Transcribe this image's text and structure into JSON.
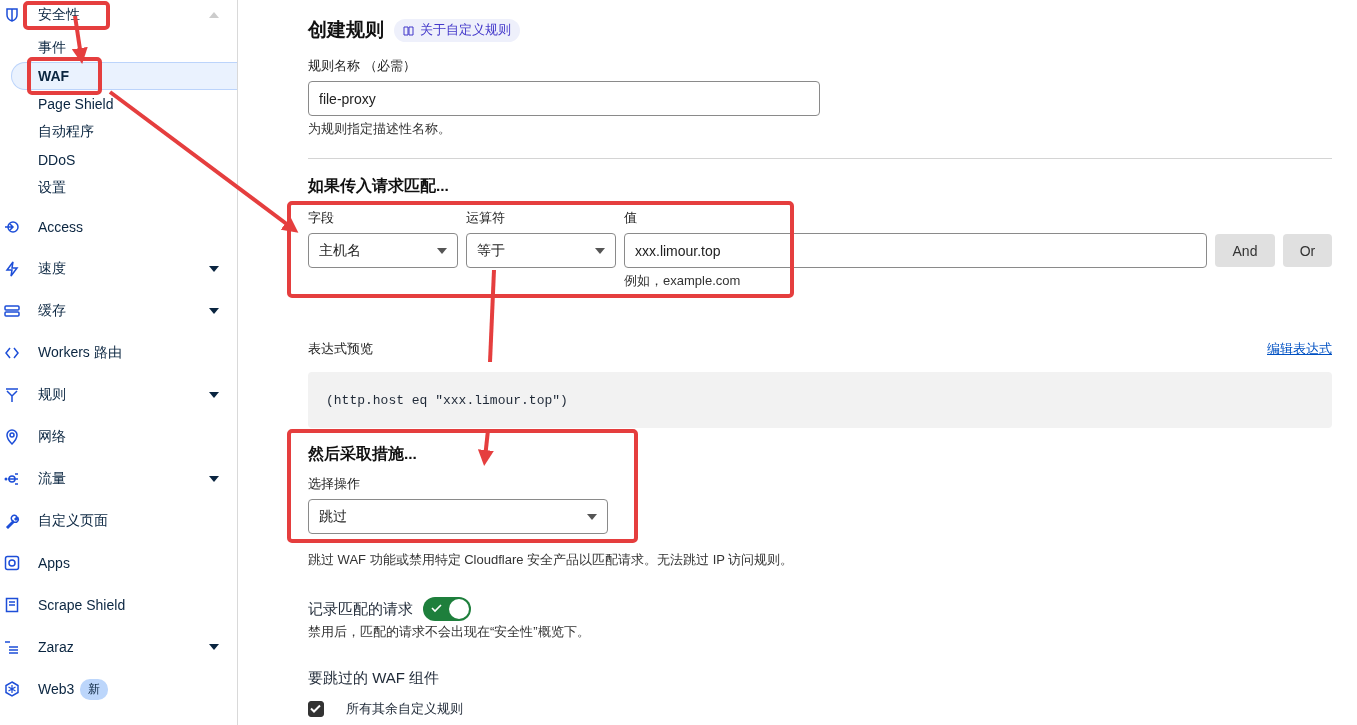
{
  "sidebar": {
    "items": [
      {
        "label": "安全性",
        "expanded": true,
        "children": [
          {
            "label": "事件",
            "selected": false
          },
          {
            "label": "WAF",
            "selected": true
          },
          {
            "label": "Page Shield",
            "selected": false
          },
          {
            "label": "自动程序",
            "selected": false
          },
          {
            "label": "DDoS",
            "selected": false
          },
          {
            "label": "设置",
            "selected": false
          }
        ]
      },
      {
        "label": "Access"
      },
      {
        "label": "速度",
        "expanded": false
      },
      {
        "label": "缓存",
        "expanded": false
      },
      {
        "label": "Workers 路由"
      },
      {
        "label": "规则",
        "expanded": false
      },
      {
        "label": "网络"
      },
      {
        "label": "流量",
        "expanded": false
      },
      {
        "label": "自定义页面"
      },
      {
        "label": "Apps"
      },
      {
        "label": "Scrape Shield"
      },
      {
        "label": "Zaraz",
        "expanded": false
      },
      {
        "label": "Web3",
        "badge": "新"
      }
    ]
  },
  "main": {
    "title": "创建规则",
    "help_link": "关于自定义规则",
    "rule_name": {
      "label": "规则名称 （必需）",
      "value": "file-proxy",
      "hint": "为规则指定描述性名称。"
    },
    "match": {
      "heading": "如果传入请求匹配...",
      "field_label": "字段",
      "operator_label": "运算符",
      "value_label": "值",
      "field": "主机名",
      "operator": "等于",
      "value": "xxx.limour.top",
      "value_hint": "例如，example.com",
      "buttons": [
        "And",
        "Or"
      ]
    },
    "expression": {
      "label": "表达式预览",
      "edit_link": "编辑表达式",
      "code": "(http.host eq \"xxx.limour.top\")"
    },
    "action": {
      "heading": "然后采取措施...",
      "label": "选择操作",
      "value": "跳过",
      "description": "跳过 WAF 功能或禁用特定 Cloudflare 安全产品以匹配请求。无法跳过 IP 访问规则。"
    },
    "log": {
      "label": "记录匹配的请求",
      "on": true,
      "hint": "禁用后，匹配的请求不会出现在“安全性”概览下。"
    },
    "components": {
      "heading": "要跳过的 WAF 组件",
      "items": [
        {
          "label": "所有其余自定义规则",
          "checked": true
        }
      ]
    }
  }
}
